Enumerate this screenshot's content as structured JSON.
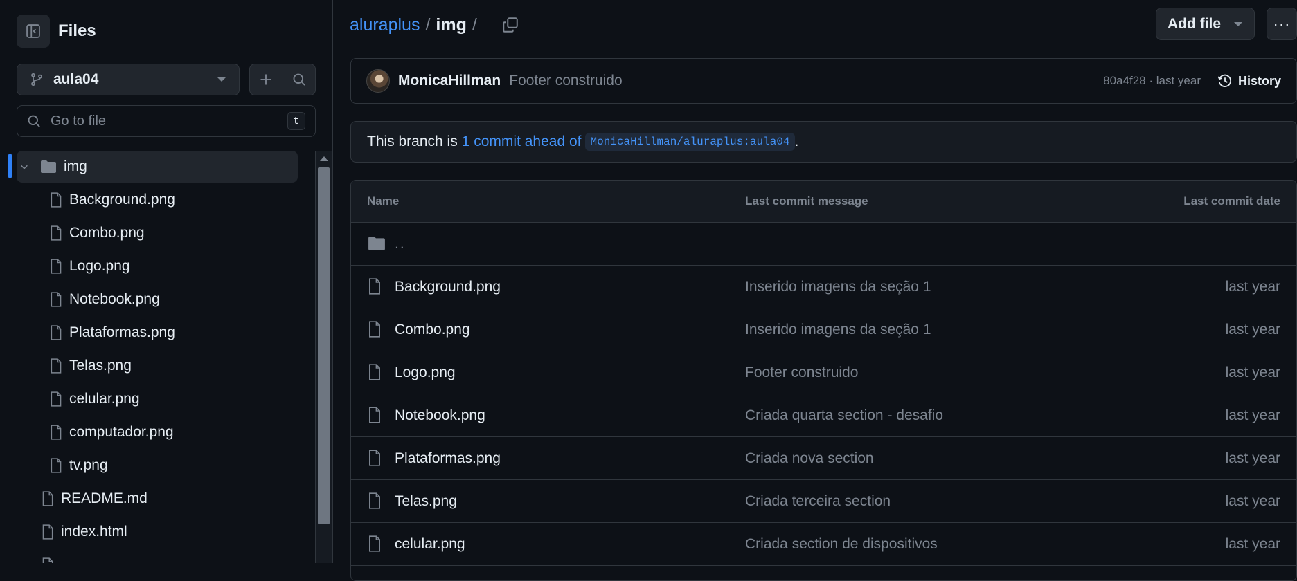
{
  "sidebar": {
    "title": "Files",
    "branch": "aula04",
    "search_placeholder": "Go to file",
    "shortcut_key": "t",
    "tree": [
      {
        "label": "img",
        "type": "folder",
        "depth": 0,
        "expanded": true,
        "active": true
      },
      {
        "label": "Background.png",
        "type": "file",
        "depth": 1
      },
      {
        "label": "Combo.png",
        "type": "file",
        "depth": 1
      },
      {
        "label": "Logo.png",
        "type": "file",
        "depth": 1
      },
      {
        "label": "Notebook.png",
        "type": "file",
        "depth": 1
      },
      {
        "label": "Plataformas.png",
        "type": "file",
        "depth": 1
      },
      {
        "label": "Telas.png",
        "type": "file",
        "depth": 1
      },
      {
        "label": "celular.png",
        "type": "file",
        "depth": 1
      },
      {
        "label": "computador.png",
        "type": "file",
        "depth": 1
      },
      {
        "label": "tv.png",
        "type": "file",
        "depth": 1
      },
      {
        "label": "README.md",
        "type": "file",
        "depth": 0
      },
      {
        "label": "index.html",
        "type": "file",
        "depth": 0
      }
    ]
  },
  "breadcrumb": {
    "repo": "aluraplus",
    "sep": "/",
    "folder": "img",
    "trailing_sep": "/"
  },
  "toolbar": {
    "add_file_label": "Add file",
    "more_label": "···"
  },
  "commit": {
    "author": "MonicaHillman",
    "message": "Footer construido",
    "meta": "80a4f28 · last year",
    "history_label": "History"
  },
  "ahead_banner": {
    "prefix": "This branch is",
    "link": "1 commit ahead of",
    "ref": "MonicaHillman/aluraplus:aula04",
    "suffix": "."
  },
  "table": {
    "headers": {
      "name": "Name",
      "message": "Last commit message",
      "date": "Last commit date"
    },
    "parent_dir": "..",
    "rows": [
      {
        "name": "Background.png",
        "message": "Inserido imagens da seção 1",
        "date": "last year"
      },
      {
        "name": "Combo.png",
        "message": "Inserido imagens da seção 1",
        "date": "last year"
      },
      {
        "name": "Logo.png",
        "message": "Footer construido",
        "date": "last year"
      },
      {
        "name": "Notebook.png",
        "message": "Criada quarta section - desafio",
        "date": "last year"
      },
      {
        "name": "Plataformas.png",
        "message": "Criada nova section",
        "date": "last year"
      },
      {
        "name": "Telas.png",
        "message": "Criada terceira section",
        "date": "last year"
      },
      {
        "name": "celular.png",
        "message": "Criada section de dispositivos",
        "date": "last year"
      }
    ]
  },
  "colors": {
    "background": "#0d1117",
    "accent_link": "#4493f8",
    "active_indicator": "#2f81f7",
    "border": "#30363d",
    "muted_text": "#7d8590"
  }
}
